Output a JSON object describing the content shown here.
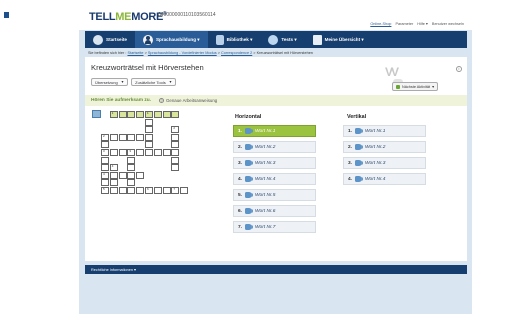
{
  "header": {
    "logo_text_a": "TELL",
    "logo_text_b": "ME",
    "logo_text_c": "MORE",
    "logo_mark": "®",
    "account_code": "040000000110103560114",
    "links": [
      {
        "label": "Online-Shop"
      },
      {
        "label": "Parameter"
      },
      {
        "label": "Hilfe ▾"
      },
      {
        "label": "Benutzer wechseln"
      }
    ]
  },
  "nav": {
    "items": [
      {
        "label": "Startseite",
        "icon": "home-icon"
      },
      {
        "label": "Sprachausbildung ▾",
        "icon": "learner-icon"
      },
      {
        "label": "Bibliothek ▾",
        "icon": "library-icon"
      },
      {
        "label": "Tests ▾",
        "icon": "tests-icon"
      },
      {
        "label": "Meine Übersicht ▾",
        "icon": "calendar-icon"
      }
    ]
  },
  "breadcrumb": {
    "prefix": "Sie befinden sich hier :",
    "crumbs": [
      "Startseite",
      "Sprachausbildung - Vordefinierter Modus",
      "Correspondence 2"
    ],
    "current": "Kreuzworträtsel mit Hörverstehen"
  },
  "page": {
    "title": "Kreuzworträtsel mit Hörverstehen",
    "select_1": "Übersetzung",
    "select_2": "Zusätzliche Tools",
    "next_button": "Nächste Aktivität",
    "info_icon": "i"
  },
  "instructions": {
    "title": "Hören Sie aufmerksam zu.",
    "link": "Genaue Arbeitsanweisung"
  },
  "horizontal": {
    "heading": "Horizontal",
    "clues": [
      {
        "num": "1.",
        "word": "Wort Nr.1",
        "active": true
      },
      {
        "num": "2.",
        "word": "Wort Nr.2",
        "active": false
      },
      {
        "num": "3.",
        "word": "Wort Nr.3",
        "active": false
      },
      {
        "num": "4.",
        "word": "Wort Nr.4",
        "active": false
      },
      {
        "num": "5.",
        "word": "Wort Nr.5",
        "active": false
      },
      {
        "num": "6.",
        "word": "Wort Nr.6",
        "active": false
      },
      {
        "num": "7.",
        "word": "Wort Nr.7",
        "active": false
      }
    ]
  },
  "vertical": {
    "heading": "Vertikal",
    "clues": [
      {
        "num": "1.",
        "word": "Wort Nr.1"
      },
      {
        "num": "2.",
        "word": "Wort Nr.2"
      },
      {
        "num": "3.",
        "word": "Wort Nr.3"
      },
      {
        "num": "4.",
        "word": "Wort Nr.4"
      }
    ]
  },
  "footer": {
    "label": "Rechtliche Informationen ▾"
  },
  "crossword": {
    "numbers": [
      "1",
      "1",
      "2",
      "2",
      "3",
      "3",
      "4",
      "4",
      "5",
      "6",
      "7"
    ]
  },
  "colors": {
    "navy": "#163e6e",
    "active_nav": "#2a5d97",
    "accent_green": "#9cc33f",
    "frame_bg": "#d9e6f1"
  }
}
